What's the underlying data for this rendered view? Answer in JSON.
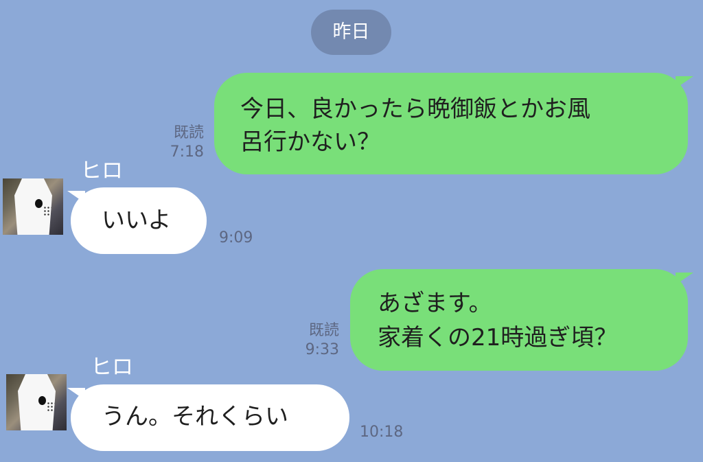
{
  "date_separator": "昨日",
  "messages": [
    {
      "direction": "outgoing",
      "text_lines": [
        "今日、良かったら晩御飯とかお風",
        "呂行かない？"
      ],
      "read_label": "既読",
      "time": "7:18"
    },
    {
      "direction": "incoming",
      "sender": "ヒロ",
      "text": "いいよ",
      "time": "9:09"
    },
    {
      "direction": "outgoing",
      "text_lines": [
        "あざます。",
        "家着くの21時過ぎ頃？"
      ],
      "read_label": "既読",
      "time": "9:33"
    },
    {
      "direction": "incoming",
      "sender": "ヒロ",
      "text": "うん。それくらい",
      "time": "10:18"
    }
  ],
  "colors": {
    "background": "#8ca9d7",
    "outgoing_bubble": "#79df79",
    "incoming_bubble": "#ffffff",
    "date_pill": "#7389b0"
  }
}
